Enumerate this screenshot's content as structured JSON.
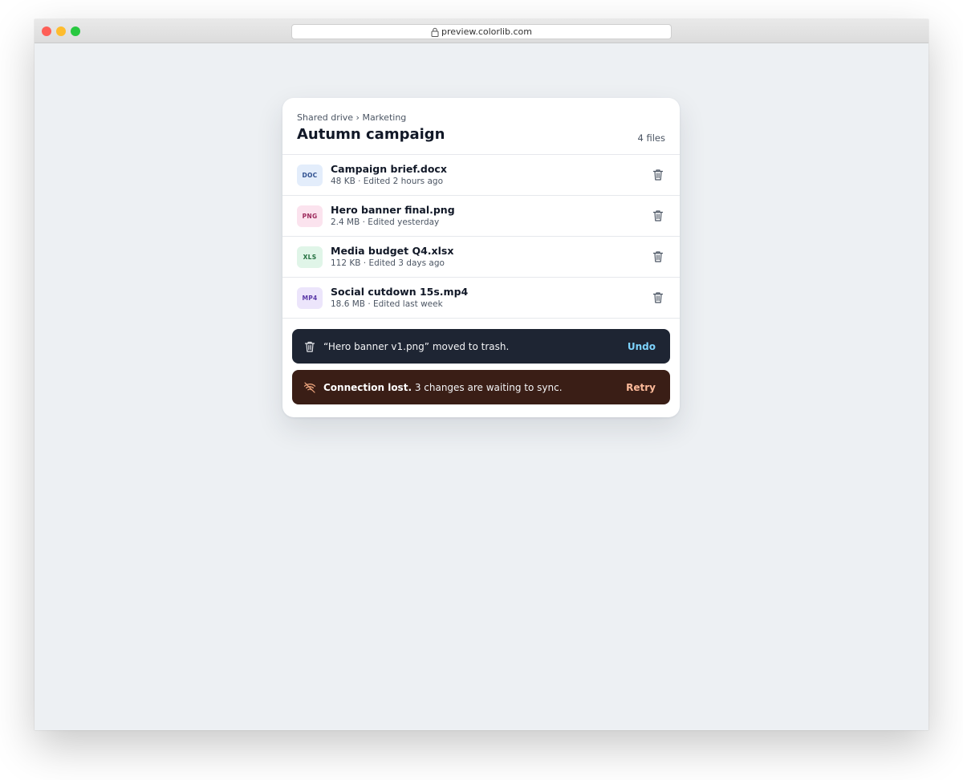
{
  "browser": {
    "url": "preview.colorlib.com"
  },
  "header": {
    "breadcrumb": "Shared drive › Marketing",
    "title": "Autumn campaign",
    "count": "4 files"
  },
  "files": [
    {
      "badge": "DOC",
      "name": "Campaign brief.docx",
      "meta": "48 KB · Edited 2 hours ago",
      "badge_bg": "#e3edfb",
      "badge_fg": "#2e4f8f"
    },
    {
      "badge": "PNG",
      "name": "Hero banner final.png",
      "meta": "2.4 MB · Edited yesterday",
      "badge_bg": "#fbe3ee",
      "badge_fg": "#9d2a5c"
    },
    {
      "badge": "XLS",
      "name": "Media budget Q4.xlsx",
      "meta": "112 KB · Edited 3 days ago",
      "badge_bg": "#e0f5e8",
      "badge_fg": "#23703f"
    },
    {
      "badge": "MP4",
      "name": "Social cutdown 15s.mp4",
      "meta": "18.6 MB · Edited last week",
      "badge_bg": "#ece5fb",
      "badge_fg": "#5b3aa8"
    }
  ],
  "toasts": {
    "trash": {
      "icon": "trash-icon",
      "message": "“Hero banner v1.png” moved to trash.",
      "action": "Undo"
    },
    "connection": {
      "icon": "wifi-off-icon",
      "bold": "Connection lost.",
      "message": " 3 changes are waiting to sync.",
      "action": "Retry"
    }
  },
  "colors": {
    "toast_dark": "#1e2533",
    "toast_error": "#3a1e16",
    "undo": "#7dd3fc",
    "retry": "#fdba9a"
  }
}
